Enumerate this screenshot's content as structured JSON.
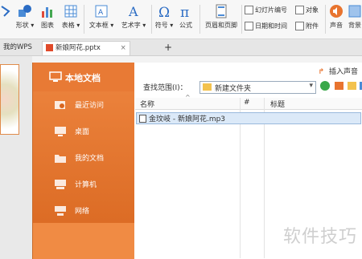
{
  "ribbon": {
    "shape_label": "形状",
    "chart_label": "图表",
    "table_label": "表格",
    "textbox_label": "文本框",
    "wordart_label": "艺术字",
    "symbol_label": "符号",
    "formula_label": "公式",
    "header_footer_label": "页眉和页脚",
    "slide_number_label": "幻灯片编号",
    "object_label": "对象",
    "datetime_label": "日期和时间",
    "attachment_label": "附件",
    "audio_label": "声音",
    "background_label": "背景"
  },
  "tabs": {
    "home_tab": "我的WPS",
    "doc_tab": "新娘阿花.pptx",
    "close_glyph": "×",
    "add_glyph": "+"
  },
  "dialog": {
    "sidebar": {
      "title": "本地文档",
      "items": [
        {
          "label": "最近访问",
          "icon": "recent-icon"
        },
        {
          "label": "桌面",
          "icon": "desktop-icon"
        },
        {
          "label": "我的文档",
          "icon": "folder-icon"
        },
        {
          "label": "计算机",
          "icon": "computer-icon"
        },
        {
          "label": "网络",
          "icon": "network-icon"
        }
      ]
    },
    "insert_audio_label": "插入声音",
    "search_range_label": "查找范围(I)：",
    "current_folder": "新建文件夹",
    "columns": {
      "name": "名称",
      "number": "#",
      "title": "标题"
    },
    "files": [
      {
        "name": "金玟岐 - 新娘阿花.mp3"
      }
    ]
  },
  "watermark": "软件技巧",
  "colors": {
    "accent": "#e8742f",
    "selection": "#dbe9f8"
  }
}
